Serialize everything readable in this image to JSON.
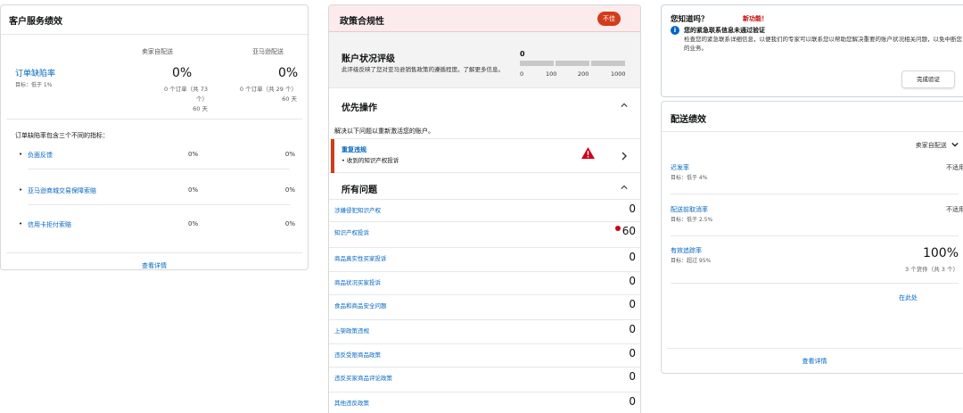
{
  "customer_service": {
    "title": "客户服务绩效",
    "col_fbm": "卖家自配送",
    "col_fba": "亚马逊配送",
    "odr": {
      "label": "订单缺陷率",
      "target": "目标：低于 1%",
      "fbm_value": "0%",
      "fbm_sub1": "0 个订单（共 73",
      "fbm_sub2": "个）",
      "fbm_sub3": "60 天",
      "fba_value": "0%",
      "fba_sub1": "0 个订单（共 29 个）",
      "fba_sub2": "60 天"
    },
    "note": "订单缺陷率包含三个不同的指标：",
    "metrics": [
      {
        "name": "负面反馈",
        "fbm": "0%",
        "fba": "0%"
      },
      {
        "name": "亚马逊商城交易保障索赔",
        "fbm": "0%",
        "fba": "0%"
      },
      {
        "name": "信用卡拒付索赔",
        "fbm": "0%",
        "fba": "0%"
      }
    ],
    "view_details": "查看详情"
  },
  "policy": {
    "title": "政策合规性",
    "badge": "不佳",
    "ahr": {
      "title": "账户状况评级",
      "desc": "此评级反映了您对亚马逊销售政策的遵循程度。了解更多信息。",
      "score": "0",
      "ticks": [
        "0",
        "100",
        "200",
        "1000"
      ]
    },
    "priority_title": "优先操作",
    "priority_note": "解决以下问题以重新激活您的账户。",
    "alert": {
      "title": "重复违规",
      "sub": "• 收到的知识产权投诉"
    },
    "all_issues_title": "所有问题",
    "issues": [
      {
        "name": "涉嫌侵犯知识产权",
        "value": "0"
      },
      {
        "name": "知识产权投诉",
        "value": "60"
      },
      {
        "name": "商品真实性买家投诉",
        "value": "0"
      },
      {
        "name": "商品状况买家投诉",
        "value": "0"
      },
      {
        "name": "食品和商品安全问题",
        "value": "0"
      },
      {
        "name": "上架政策违规",
        "value": "0"
      },
      {
        "name": "违反受限商品政策",
        "value": "0"
      },
      {
        "name": "违反买家商品评论政策",
        "value": "0"
      },
      {
        "name": "其他违反政策",
        "value": "0"
      }
    ]
  },
  "did_you_know": {
    "title": "您知道吗？",
    "new": "新功能！",
    "head": "您的紧急联系信息未通过验证",
    "body": "检查您的紧急联系详细信息，以便我们的专家可以联系您以帮助您解决重要的账户状况相关问题，以免中断您的业务。",
    "button": "完成验证"
  },
  "shipping": {
    "title": "配送绩效",
    "filter": "卖家自配送",
    "rows": [
      {
        "name": "迟发率",
        "target": "目标：低于 4%",
        "value": "不适用"
      },
      {
        "name": "配送前取消率",
        "target": "目标：低于 2.5%",
        "value": "不适用"
      },
      {
        "name": "有效追踪率",
        "target": "目标：超过 95%",
        "value": ""
      }
    ],
    "vtr_value": "100%",
    "vtr_sub": "3 个货件（共 3 个）",
    "here": "在此处",
    "view_details": "查看详情"
  }
}
